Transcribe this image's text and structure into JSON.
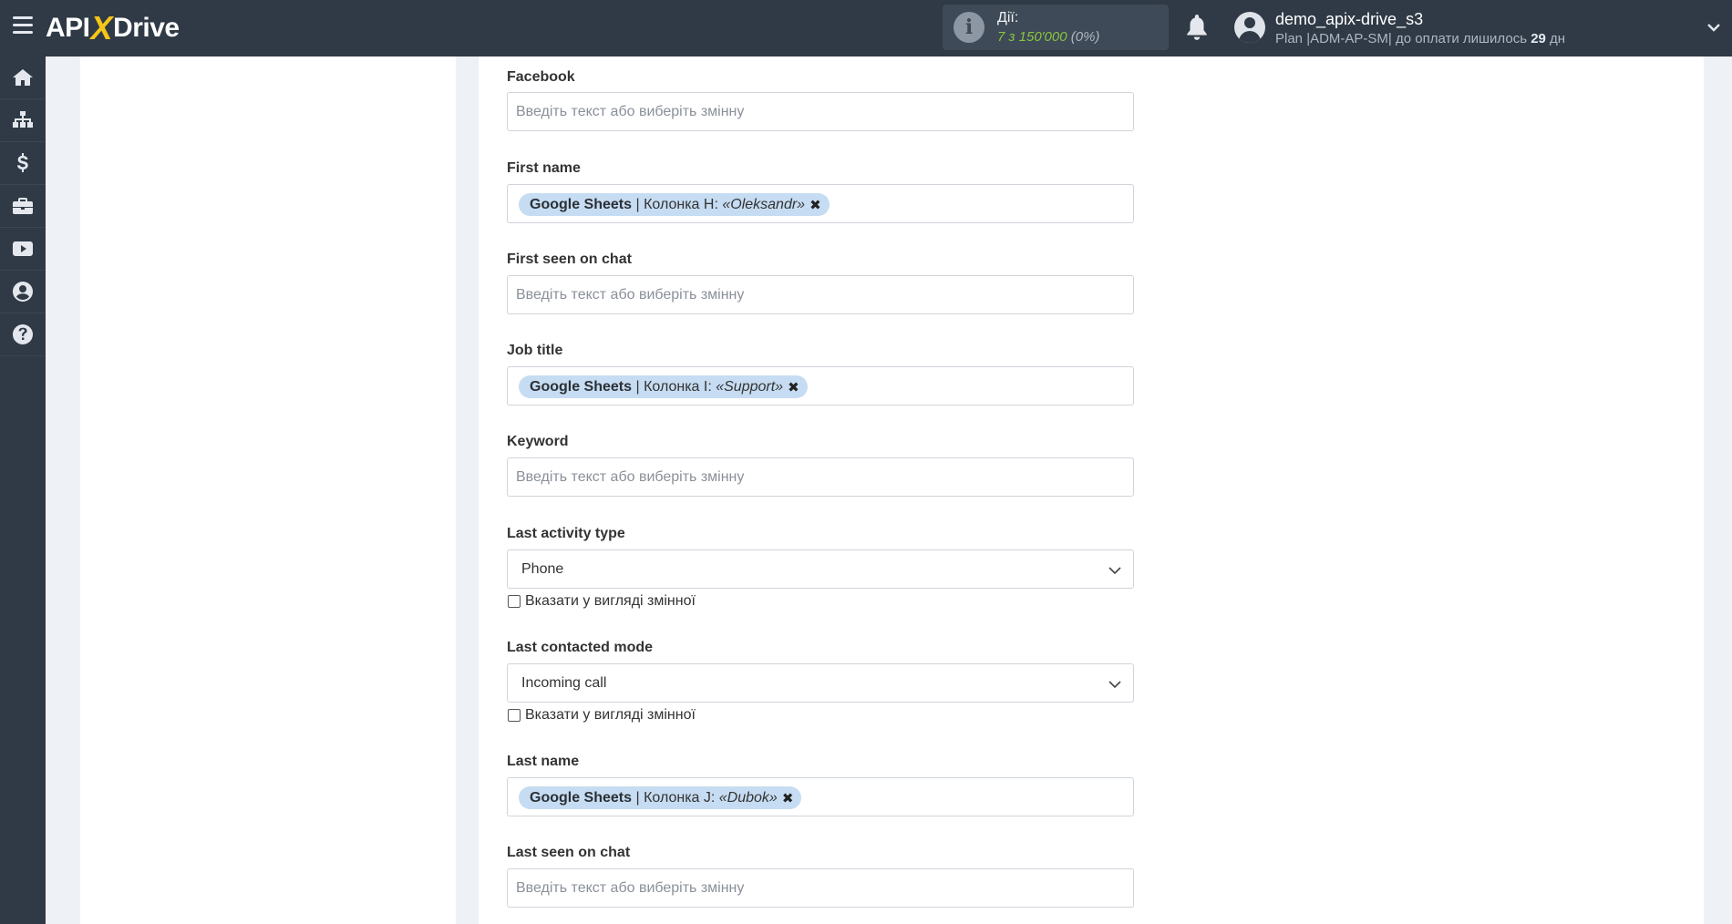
{
  "header": {
    "logo": {
      "left": "API",
      "x": "X",
      "right": "Drive"
    },
    "actions": {
      "label": "Дії:",
      "count": "7 з 150'000",
      "percent": "(0%)"
    },
    "user": {
      "name": "demo_apix-drive_s3",
      "plan_prefix": "Plan |ADM-AP-SM| до оплати лишилось ",
      "days": "29",
      "plan_suffix": " дн"
    }
  },
  "sidebar": {
    "items": [
      {
        "icon": "home-icon"
      },
      {
        "icon": "sitemap-icon"
      },
      {
        "icon": "dollar-icon"
      },
      {
        "icon": "briefcase-icon"
      },
      {
        "icon": "youtube-icon"
      },
      {
        "icon": "user-circle-icon"
      },
      {
        "icon": "question-circle-icon"
      }
    ]
  },
  "form": {
    "placeholder": "Введіть текст або виберіть змінну",
    "fields": {
      "facebook": {
        "label": "Facebook"
      },
      "first_name": {
        "label": "First name",
        "tag": {
          "source": "Google Sheets",
          "column": " | Колонка H: ",
          "value": "«Oleksandr»"
        }
      },
      "first_seen": {
        "label": "First seen on chat"
      },
      "job_title": {
        "label": "Job title",
        "tag": {
          "source": "Google Sheets",
          "column": " | Колонка I: ",
          "value": "«Support»"
        }
      },
      "keyword": {
        "label": "Keyword"
      },
      "last_activity_type": {
        "label": "Last activity type",
        "value": "Phone",
        "checkbox_label": "Вказати у вигляді змінної"
      },
      "last_contacted_mode": {
        "label": "Last contacted mode",
        "value": "Incoming call",
        "checkbox_label": "Вказати у вигляді змінної"
      },
      "last_name": {
        "label": "Last name",
        "tag": {
          "source": "Google Sheets",
          "column": " | Колонка J: ",
          "value": "«Dubok»"
        }
      },
      "last_seen": {
        "label": "Last seen on chat"
      }
    },
    "remove_glyph": "✖"
  },
  "colors": {
    "topbar": "#2f3a46",
    "accent_yellow": "#f5c518",
    "count_green": "#8ac43f",
    "tag_bg": "#c6dcf2"
  }
}
